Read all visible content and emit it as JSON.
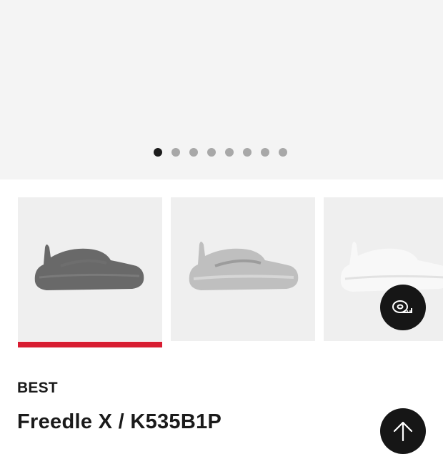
{
  "carousel": {
    "slide_count": 8,
    "active_index": 0
  },
  "thumbnails": [
    {
      "name": "thumb-black",
      "selected": true,
      "color": "#5b5b5b"
    },
    {
      "name": "thumb-grey",
      "selected": false,
      "color": "#a7a7a7"
    },
    {
      "name": "thumb-white",
      "selected": false,
      "color": "#e6e6e6"
    }
  ],
  "product": {
    "badge": "BEST",
    "title": "Freedle X / K535B1P"
  },
  "buttons": {
    "size_guide_icon": "tape-measure-icon",
    "scroll_top_icon": "arrow-up-icon"
  },
  "colors": {
    "accent": "#d81c31",
    "fab": "#161616",
    "hero_bg": "#f4f4f4"
  }
}
